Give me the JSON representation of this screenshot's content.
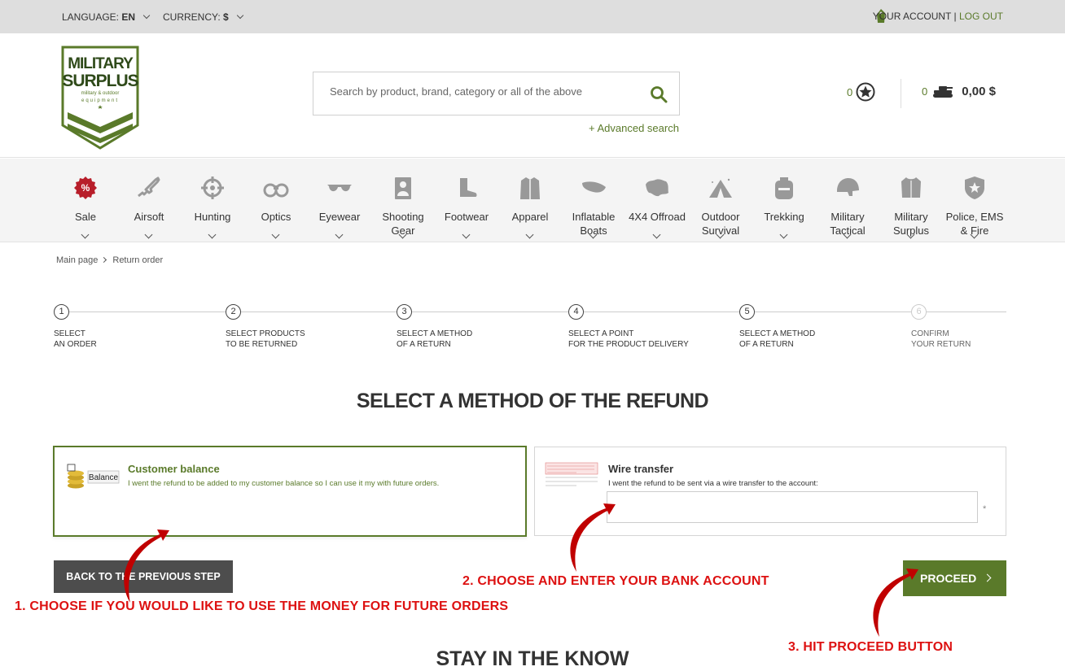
{
  "topbar": {
    "language_label": "LANGUAGE:",
    "language_value": "EN",
    "currency_label": "CURRENCY:",
    "currency_value": "$",
    "account_link": "YOUR ACCOUNT",
    "separator": "|",
    "logout_link": "LOG OUT"
  },
  "header": {
    "logo": {
      "line1": "MILITARY",
      "line2": "SURPLUS",
      "line3": "military & outdoor",
      "line4": "equipment"
    },
    "search_placeholder": "Search by product, brand, category or all of the above",
    "advanced_search": "+ Advanced search",
    "favorites_count": "0",
    "cart_count": "0",
    "cart_total": "0,00 $"
  },
  "nav": [
    {
      "label": "Sale",
      "icon": "sale-icon"
    },
    {
      "label": "Airsoft",
      "icon": "rifle-icon"
    },
    {
      "label": "Hunting",
      "icon": "crosshair-icon"
    },
    {
      "label": "Optics",
      "icon": "binoculars-icon"
    },
    {
      "label": "Eyewear",
      "icon": "sunglasses-icon"
    },
    {
      "label": "Shooting Gear",
      "icon": "target-icon"
    },
    {
      "label": "Footwear",
      "icon": "boot-icon"
    },
    {
      "label": "Apparel",
      "icon": "jacket-icon"
    },
    {
      "label": "Inflatable Boats",
      "icon": "boat-icon"
    },
    {
      "label": "4X4 Offroad",
      "icon": "map-icon"
    },
    {
      "label": "Outdoor Survival",
      "icon": "tent-icon"
    },
    {
      "label": "Trekking",
      "icon": "backpack-icon"
    },
    {
      "label": "Military Tactical",
      "icon": "helmet-icon"
    },
    {
      "label": "Military Surplus",
      "icon": "vest-icon"
    },
    {
      "label": "Police, EMS & Fire",
      "icon": "badge-icon"
    }
  ],
  "breadcrumb": {
    "home": "Main page",
    "current": "Return order"
  },
  "steps": [
    {
      "num": "1",
      "line1": "SELECT",
      "line2": "AN ORDER"
    },
    {
      "num": "2",
      "line1": "SELECT PRODUCTS",
      "line2": "TO BE RETURNED"
    },
    {
      "num": "3",
      "line1": "SELECT A METHOD",
      "line2": "OF A RETURN"
    },
    {
      "num": "4",
      "line1": "SELECT A POINT",
      "line2": "FOR THE PRODUCT DELIVERY"
    },
    {
      "num": "5",
      "line1": "SELECT A METHOD",
      "line2": "OF A RETURN"
    },
    {
      "num": "6",
      "line1": "CONFIRM",
      "line2": "YOUR RETURN"
    }
  ],
  "heading": "SELECT A METHOD OF THE REFUND",
  "options": {
    "balance": {
      "thumb_label": "Balance",
      "title": "Customer balance",
      "desc": "I went the refund to be added to my customer balance so I can use it my with future orders."
    },
    "wire": {
      "title": "Wire transfer",
      "desc": "I went the refund to be sent via a wire transfer to the account:",
      "account_value": "",
      "required_mark": "*"
    }
  },
  "buttons": {
    "back": "BACK TO THE PREVIOUS STEP",
    "proceed": "PROCEED"
  },
  "annotations": {
    "a1": "1. CHOOSE IF YOU WOULD LIKE TO USE THE MONEY FOR FUTURE ORDERS",
    "a2": "2. CHOOSE AND ENTER YOUR BANK ACCOUNT",
    "a3": "3. HIT PROCEED BUTTON"
  },
  "footer_heading": "STAY IN THE KNOW",
  "colors": {
    "accent": "#5a7a2a",
    "annotation": "#dd1111",
    "dark_button": "#4d4d4d"
  }
}
